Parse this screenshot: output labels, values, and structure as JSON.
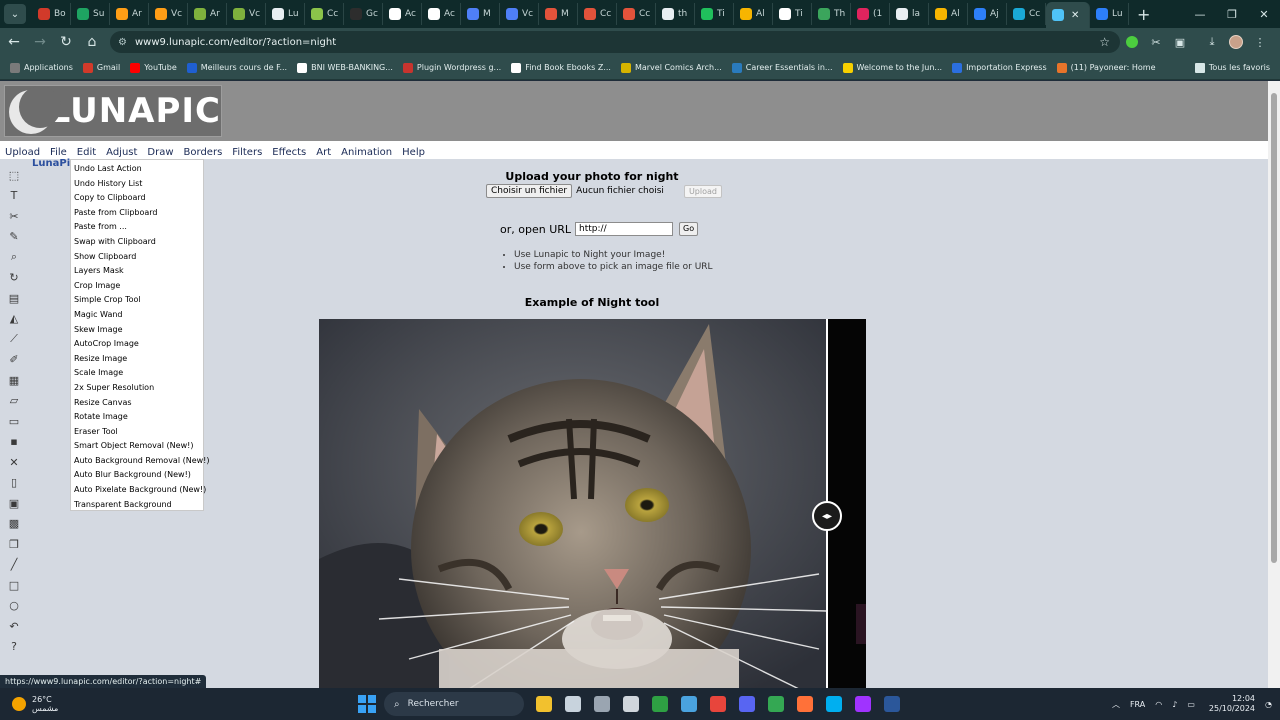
{
  "browser": {
    "tabs": [
      {
        "label": "Bo",
        "color": "#d23a2a"
      },
      {
        "label": "Su",
        "color": "#1ea362"
      },
      {
        "label": "Ar",
        "color": "#ff9e16"
      },
      {
        "label": "Vc",
        "color": "#ff9e16"
      },
      {
        "label": "Ar",
        "color": "#7fb13d"
      },
      {
        "label": "Vc",
        "color": "#7fb13d"
      },
      {
        "label": "Lu",
        "color": "#e8eef2"
      },
      {
        "label": "Cc",
        "color": "#8bc34a"
      },
      {
        "label": "Gc",
        "color": "#2d2d2d"
      },
      {
        "label": "Ac",
        "color": "#ffffff"
      },
      {
        "label": "Ac",
        "color": "#ffffff"
      },
      {
        "label": "M",
        "color": "#4f7ff7"
      },
      {
        "label": "Vc",
        "color": "#4f7ff7"
      },
      {
        "label": "M",
        "color": "#e2533b"
      },
      {
        "label": "Cc",
        "color": "#e2533b"
      },
      {
        "label": "Cc",
        "color": "#e2533b"
      },
      {
        "label": "th",
        "color": "#e8eef2"
      },
      {
        "label": "Ti",
        "color": "#20c05c"
      },
      {
        "label": "Al",
        "color": "#f7b500"
      },
      {
        "label": "Ti",
        "color": "#ffffff"
      },
      {
        "label": "Th",
        "color": "#3ba55c"
      },
      {
        "label": "(1",
        "color": "#e0245e"
      },
      {
        "label": "la",
        "color": "#e8eef2"
      },
      {
        "label": "Al",
        "color": "#f7b500"
      },
      {
        "label": "Aj",
        "color": "#2d7ff9"
      },
      {
        "label": "Cc",
        "color": "#1aa9d6"
      },
      {
        "label": "",
        "color": "#4fc3f7",
        "active": true
      },
      {
        "label": "Lu",
        "color": "#2d7ff9"
      }
    ],
    "url": "www9.lunapic.com/editor/?action=night",
    "bookmarks": [
      {
        "label": "Applications",
        "color": "#7a7a7a"
      },
      {
        "label": "Gmail",
        "color": "#d23a2a"
      },
      {
        "label": "YouTube",
        "color": "#ff0000"
      },
      {
        "label": "Meilleurs cours de F...",
        "color": "#1f5fd1"
      },
      {
        "label": "BNI WEB-BANKING...",
        "color": "#ffffff"
      },
      {
        "label": "Plugin Wordpress g...",
        "color": "#c7342e"
      },
      {
        "label": "Find Book Ebooks Z...",
        "color": "#ffffff"
      },
      {
        "label": "Marvel Comics Arch...",
        "color": "#d6b400"
      },
      {
        "label": "Career Essentials in...",
        "color": "#2a7bbd"
      },
      {
        "label": "Welcome to the Jun...",
        "color": "#f7d000"
      },
      {
        "label": "Importation Express",
        "color": "#2b6fe0"
      },
      {
        "label": "(11) Payoneer: Home",
        "color": "#e8742a"
      }
    ],
    "all_bookmarks": "Tous les favoris"
  },
  "lunapic": {
    "logo_text": "LUNAPIC",
    "menubar": [
      "Upload",
      "File",
      "Edit",
      "Adjust",
      "Draw",
      "Borders",
      "Filters",
      "Effects",
      "Art",
      "Animation",
      "Help"
    ],
    "title_link": "LunaPic",
    "tools": [
      "select-icon",
      "text-icon",
      "scissors-icon",
      "pencil-icon",
      "zoom-icon",
      "rotate-icon",
      "canvas-icon",
      "paint-bucket-icon",
      "eyedropper-icon",
      "brush-icon",
      "layers-icon",
      "eraser-icon",
      "open-folder-icon",
      "save-icon",
      "close-icon",
      "new-file-icon",
      "print-icon",
      "image-stack-icon",
      "copy-icon",
      "line-icon",
      "rectangle-icon",
      "circle-icon",
      "undo-icon",
      "help-icon"
    ],
    "edit_menu": [
      "Undo Last Action",
      "Undo History List",
      "Copy to Clipboard",
      "Paste from Clipboard",
      "Paste from ...",
      "Swap with Clipboard",
      "Show Clipboard",
      "Layers Mask",
      "Crop Image",
      "Simple Crop Tool",
      "Magic Wand",
      "Skew Image",
      "AutoCrop Image",
      "Resize Image",
      "Scale Image",
      "2x Super Resolution",
      "Resize Canvas",
      "Rotate Image",
      "Eraser Tool",
      "Smart Object Removal (New!)",
      "Auto Background Removal (New!)",
      "Auto Blur Background (New!)",
      "Auto Pixelate Background (New!)",
      "Transparent Background"
    ],
    "upload_title": "Upload your photo for night",
    "file_button": "Choisir un fichier",
    "file_none": "Aucun fichier choisi",
    "upload_button": "Upload",
    "url_label": "or, open URL",
    "url_value": "http://",
    "go_button": "Go",
    "tips": [
      "Use Lunapic to Night your Image!",
      "Use form above to pick an image file or URL"
    ],
    "example_title": "Example of Night tool"
  },
  "status_url": "https://www9.lunapic.com/editor/?action=night#",
  "taskbar": {
    "temp": "26°C",
    "weather_desc": "مشمس",
    "search": "Rechercher",
    "lang": "FRA",
    "time": "12:04",
    "date": "25/10/2024",
    "apps": [
      {
        "name": "file-explorer-icon",
        "color": "#f2c12e"
      },
      {
        "name": "task-view-icon",
        "color": "#c8d3dd"
      },
      {
        "name": "terminal-icon",
        "color": "#9aa5b1"
      },
      {
        "name": "media-icon",
        "color": "#d0d6dc"
      },
      {
        "name": "xbox-icon",
        "color": "#2ea043"
      },
      {
        "name": "photos-icon",
        "color": "#4aa3df"
      },
      {
        "name": "chrome-icon",
        "color": "#e8453c"
      },
      {
        "name": "discord-icon",
        "color": "#5865f2"
      },
      {
        "name": "chrome-profile-icon",
        "color": "#34a853"
      },
      {
        "name": "firefox-icon",
        "color": "#ff7139"
      },
      {
        "name": "skype-icon",
        "color": "#00aff0"
      },
      {
        "name": "messenger-icon",
        "color": "#a033ff"
      },
      {
        "name": "word-icon",
        "color": "#2b579a"
      }
    ]
  }
}
